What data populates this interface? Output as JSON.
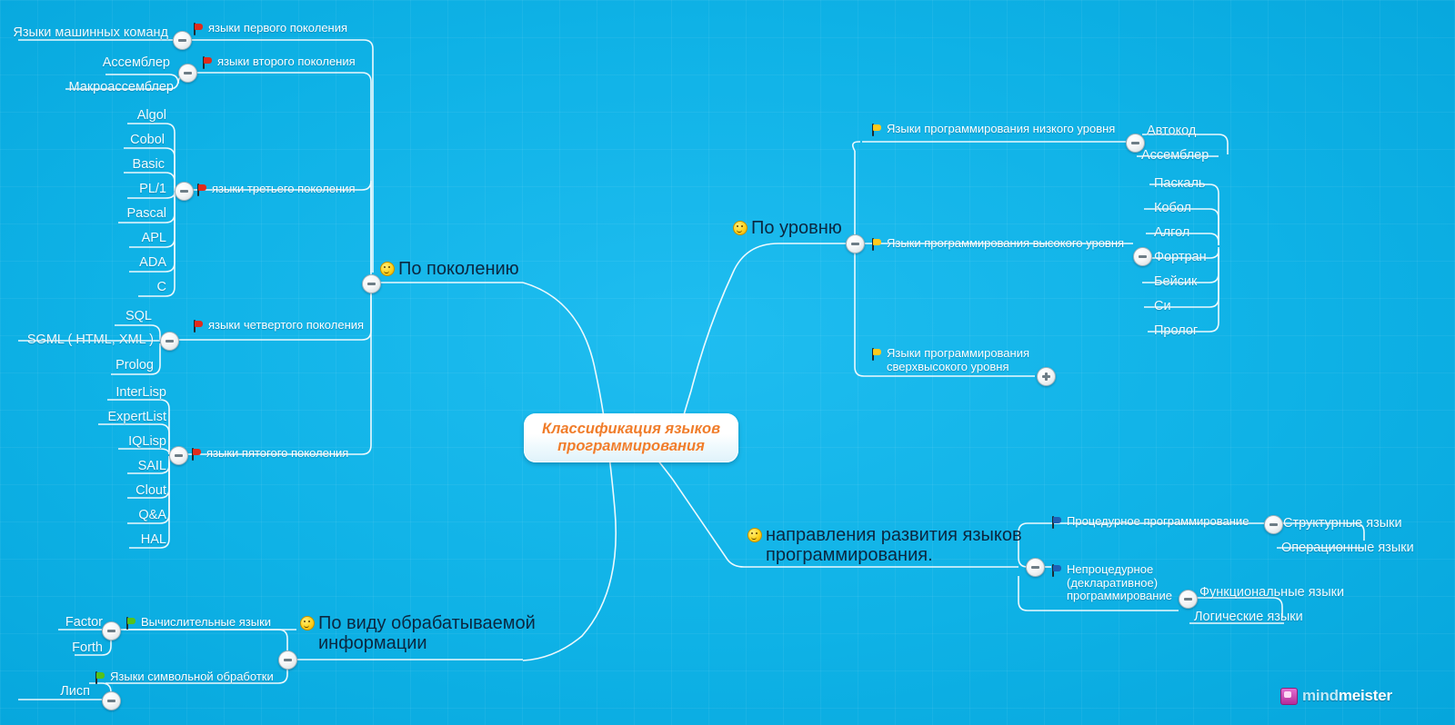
{
  "app": {
    "logo_text_part1": "mind",
    "logo_text_part2": "meister",
    "logo_mark_icon": "mindmeister-logo-icon"
  },
  "root": {
    "label": "Классификация языков программирования",
    "color": "#f07d2b"
  },
  "icons": {
    "smiley": "smiley-icon",
    "flag_red": "red-flag-icon",
    "flag_yellow": "yellow-flag-icon",
    "flag_green": "green-flag-icon",
    "flag_blue": "blue-flag-icon",
    "collapse": "minus-toggle-icon",
    "expand": "plus-toggle-icon"
  },
  "branches": {
    "generation": {
      "label": "По поколению",
      "groups": [
        {
          "label": "языки первого поколения",
          "flag": "red",
          "children": [
            "Языки машинных команд"
          ]
        },
        {
          "label": "языки второго поколения",
          "flag": "red",
          "children": [
            "Ассемблер",
            "Макроассемблер"
          ]
        },
        {
          "label": "языки третьего поколения",
          "flag": "red",
          "children": [
            "Algol",
            "Cobol",
            "Basic",
            "PL/1",
            "Pascal",
            "APL",
            "ADA",
            "C"
          ]
        },
        {
          "label": "языки четвертого поколения",
          "flag": "red",
          "children": [
            "SQL",
            "SGML ( HTML, XML )",
            "Prolog"
          ]
        },
        {
          "label": "языки пятогого поколения",
          "flag": "red",
          "children": [
            "InterLisp",
            "ExpertList",
            "IQLisp",
            "SAIL",
            "Clout",
            "Q&A",
            "HAL"
          ]
        }
      ]
    },
    "level": {
      "label": "По уровню",
      "groups": [
        {
          "label": "Языки программирования низкого уровня",
          "flag": "yellow",
          "children": [
            "Автокод",
            "Ассемблер"
          ]
        },
        {
          "label": "Языки программирования высокого уровня",
          "flag": "yellow",
          "children": [
            "Паскаль",
            "Кобол",
            "Алгол",
            "Фортран",
            "Бейсик",
            "Си",
            "Пролог"
          ]
        },
        {
          "label": "Языки программирования сверхвысокого уровня",
          "flag": "yellow",
          "collapsed": true,
          "children": []
        }
      ]
    },
    "directions": {
      "label": "направления развития языков программирования.",
      "groups": [
        {
          "label": "Процедурное программирование",
          "flag": "blue",
          "children": [
            "Структурные языки",
            "Операционные языки"
          ]
        },
        {
          "label": "Непроцедурное (декларативное) программирование",
          "flag": "blue",
          "children": [
            "Функциональные языки",
            "Логические языки"
          ]
        }
      ]
    },
    "information": {
      "label": "По виду обрабатываемой информации",
      "groups": [
        {
          "label": "Вычислительные языки",
          "flag": "green",
          "children": [
            "Factor",
            "Forth"
          ]
        },
        {
          "label": "Языки символьной обработки",
          "flag": "green",
          "children": [
            "Лисп"
          ]
        }
      ]
    }
  }
}
